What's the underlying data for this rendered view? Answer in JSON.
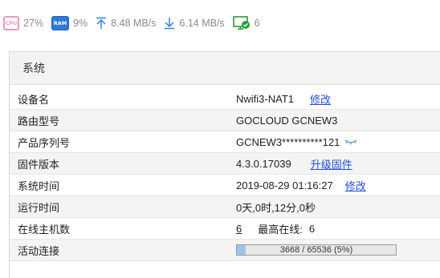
{
  "status": {
    "cpu_label": "CPU",
    "cpu": "27%",
    "ram_label": "RAM",
    "ram": "9%",
    "upload": "8.48 MB/s",
    "download": "6.14 MB/s",
    "devices": "6"
  },
  "section": {
    "title": "系统",
    "rows": [
      {
        "label": "设备名",
        "value": "Nwifi3-NAT1",
        "link": "修改"
      },
      {
        "label": "路由型号",
        "value": "GOCLOUD GCNEW3"
      },
      {
        "label": "产品序列号",
        "value": "GCNEW3**********121"
      },
      {
        "label": "固件版本",
        "value": "4.3.0.17039",
        "link": "升级固件"
      },
      {
        "label": "系统时间",
        "value": "2019-08-29 01:16:27",
        "link": "修改"
      },
      {
        "label": "运行时间",
        "value": "0天,0时,12分,0秒"
      },
      {
        "label": "在线主机数",
        "value": "6",
        "extra_label": "最高在线:",
        "extra_value": "6"
      },
      {
        "label": "活动连接",
        "progress_text": "3668 / 65536 (5%)",
        "progress_fraction": 0.056
      }
    ]
  },
  "colors": {
    "link": "#1e4fd6",
    "row_alt": "#f4f4f4",
    "header_bg": "#f3f3f3"
  }
}
